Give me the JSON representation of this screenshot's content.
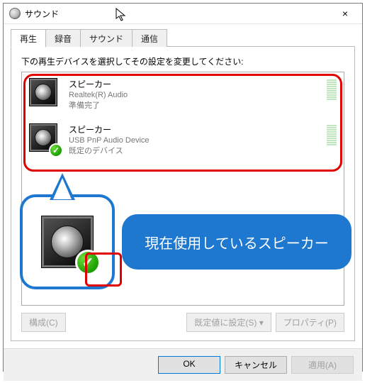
{
  "window": {
    "title": "サウンド",
    "close_label": "×"
  },
  "tabs": [
    {
      "label": "再生",
      "active": true
    },
    {
      "label": "録音",
      "active": false
    },
    {
      "label": "サウンド",
      "active": false
    },
    {
      "label": "通信",
      "active": false
    }
  ],
  "instruction": "下の再生デバイスを選択してその設定を変更してください:",
  "devices": [
    {
      "name": "スピーカー",
      "driver": "Realtek(R) Audio",
      "status": "準備完了",
      "default": false
    },
    {
      "name": "スピーカー",
      "driver": "USB PnP Audio Device",
      "status": "既定のデバイス",
      "default": true
    }
  ],
  "buttons": {
    "configure": "構成(C)",
    "set_default": "既定値に設定(S)",
    "properties": "プロパティ(P)",
    "ok": "OK",
    "cancel": "キャンセル",
    "apply": "適用(A)"
  },
  "annotation": {
    "label": "現在使用しているスピーカー"
  }
}
